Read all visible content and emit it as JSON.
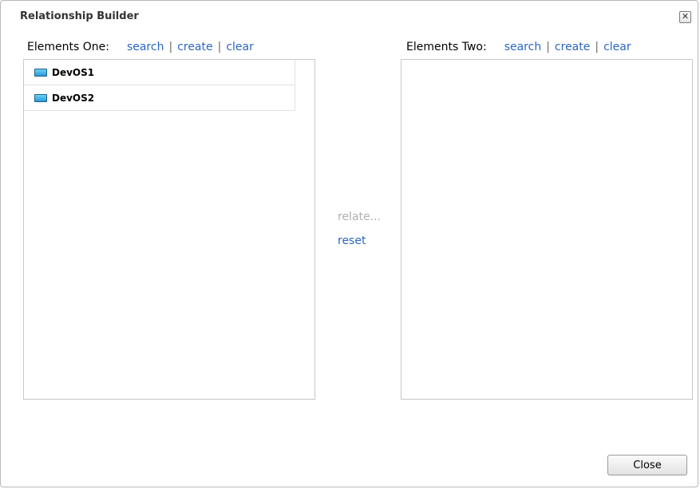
{
  "dialog": {
    "title": "Relationship Builder",
    "close_glyph": "✕"
  },
  "elements_one": {
    "label": "Elements One:",
    "search": "search",
    "create": "create",
    "clear": "clear",
    "items": [
      {
        "label": "DevOS1",
        "icon": "device-icon"
      },
      {
        "label": "DevOS2",
        "icon": "device-icon"
      }
    ]
  },
  "elements_two": {
    "label": "Elements Two:",
    "search": "search",
    "create": "create",
    "clear": "clear",
    "items": []
  },
  "actions": {
    "relate": "relate...",
    "reset": "reset"
  },
  "footer": {
    "close_label": "Close"
  },
  "colors": {
    "link": "#2a66c2",
    "disabled": "#b0b0b0"
  }
}
